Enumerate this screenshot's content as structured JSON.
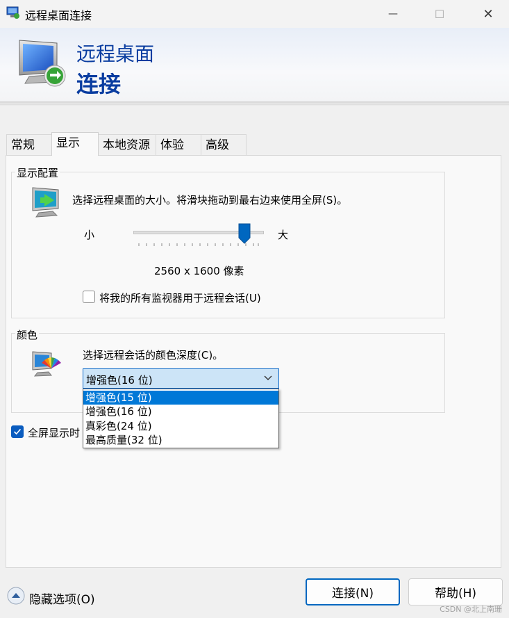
{
  "window": {
    "title": "远程桌面连接",
    "minimize_glyph": "—",
    "maximize_glyph": "☐",
    "close_glyph": "✕"
  },
  "banner": {
    "line1": "远程桌面",
    "line2": "连接"
  },
  "tabs": [
    {
      "label": "常规",
      "active": false
    },
    {
      "label": "显示",
      "active": true
    },
    {
      "label": "本地资源",
      "active": false
    },
    {
      "label": "体验",
      "active": false
    },
    {
      "label": "高级",
      "active": false
    }
  ],
  "display_config": {
    "label": "显示配置",
    "description": "选择远程桌面的大小。将滑块拖动到最右边来使用全屏(S)。",
    "slider_min_label": "小",
    "slider_max_label": "大",
    "slider_position_fraction": 0.85,
    "resolution": "2560 x 1600 像素",
    "use_all_monitors": {
      "label": "将我的所有监视器用于远程会话(U)",
      "checked": false
    }
  },
  "colors": {
    "label": "颜色",
    "description": "选择远程会话的颜色深度(C)。",
    "selected_value": "增强色(16 位)",
    "options": [
      {
        "label": "增强色(15 位)",
        "highlighted": true
      },
      {
        "label": "增强色(16 位)",
        "highlighted": false
      },
      {
        "label": "真彩色(24 位)",
        "highlighted": false
      },
      {
        "label": "最高质量(32 位)",
        "highlighted": false
      }
    ]
  },
  "fullscreen_bar": {
    "label": "全屏显示时",
    "checked": true
  },
  "footer": {
    "hide_options_label": "隐藏选项(O)",
    "connect_label": "连接(N)",
    "help_label": "帮助(H)"
  },
  "watermark": "CSDN @北上南珊",
  "colors_theme": {
    "accent": "#0078d7",
    "title_blue": "#0a3da0",
    "checkbox_blue": "#0a5cbf"
  }
}
